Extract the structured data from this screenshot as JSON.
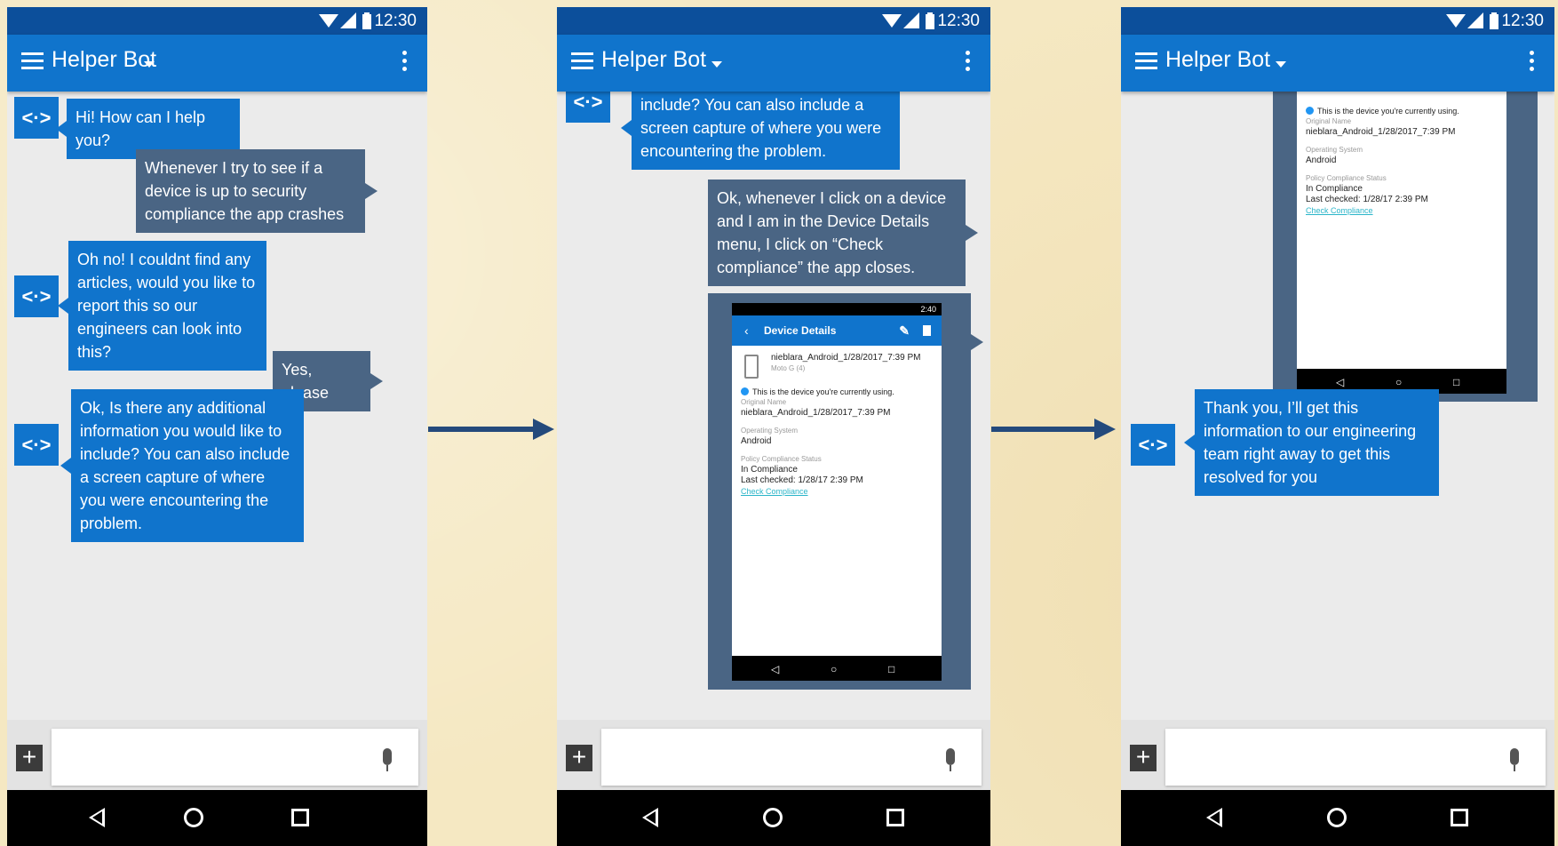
{
  "status_time": "12:30",
  "app_title": "Helper Bot",
  "avatar_glyph": "<·>",
  "input_plus": "+",
  "panel1": {
    "messages": [
      "Hi! How can I help you?",
      "Whenever I try to see if a device is up to security compliance the app crashes",
      "Oh no! I couldnt find any articles, would you like to report this so our engineers can look into this?",
      "Yes, please",
      "Ok, Is there any additional information you would like to include? You can also include a screen capture of where you were encountering the problem."
    ]
  },
  "panel2": {
    "messages": [
      "include? You can also include a screen capture of where you were encountering the problem.",
      "Ok, whenever I click on a device and I am in the Device Details menu, I click on “Check compliance” the app closes."
    ]
  },
  "panel3": {
    "messages": [
      "Thank you, I’ll get this information to our engineering team right away to get this resolved for you"
    ]
  },
  "device_screen": {
    "status_time": "2:40",
    "title": "Device Details",
    "device_name": "nieblara_Android_1/28/2017_7:39 PM",
    "device_model": "Moto G (4)",
    "current_note": "This is the device you're currently using.",
    "original_name_label": "Original Name",
    "original_name": "nieblara_Android_1/28/2017_7:39 PM",
    "os_label": "Operating System",
    "os": "Android",
    "policy_label": "Policy Compliance Status",
    "policy": "In Compliance",
    "last_checked": "Last checked: 1/28/17 2:39 PM",
    "check_link": "Check Compliance"
  }
}
